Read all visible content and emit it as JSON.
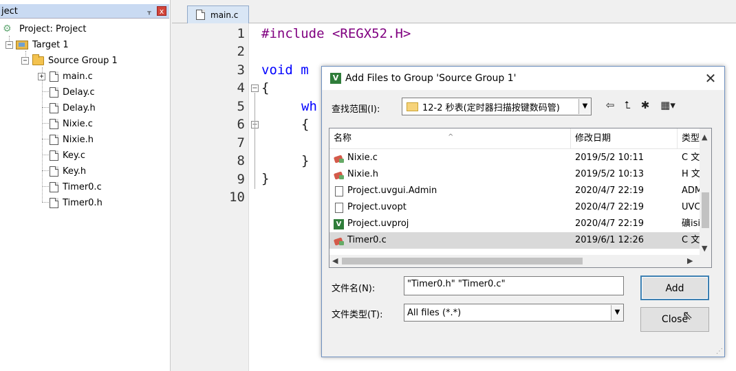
{
  "project_panel": {
    "title": "ject",
    "pin": "⊥",
    "close": "x",
    "tree": {
      "project": "Project: Project",
      "target": "Target 1",
      "group": "Source Group 1",
      "files": [
        "main.c",
        "Delay.c",
        "Delay.h",
        "Nixie.c",
        "Nixie.h",
        "Key.c",
        "Key.h",
        "Timer0.c",
        "Timer0.h"
      ]
    }
  },
  "editor": {
    "tab": "main.c",
    "line_numbers": [
      "1",
      "2",
      "3",
      "4",
      "5",
      "6",
      "7",
      "8",
      "9",
      "10"
    ],
    "code": {
      "l1": "#include <REGX52.H>",
      "l3": "void m",
      "l4": "{",
      "l5": "wh",
      "l6": "{",
      "l8": "}",
      "l9": "}"
    }
  },
  "dialog": {
    "title": "Add Files to Group 'Source Group 1'",
    "close": "✕",
    "look_in_label": "查找范围(I):",
    "look_in_value": "12-2 秒表(定时器扫描按键数码管)",
    "columns": {
      "name": "名称",
      "date": "修改日期",
      "type": "类型"
    },
    "files": [
      {
        "name": "Nixie.c",
        "date": "2019/5/2 10:11",
        "type": "C 文",
        "icon": "c-source-icon"
      },
      {
        "name": "Nixie.h",
        "date": "2019/5/2 10:13",
        "type": "H 文",
        "icon": "c-header-icon"
      },
      {
        "name": "Project.uvgui.Admin",
        "date": "2020/4/7 22:19",
        "type": "ADM",
        "icon": "generic-file-icon"
      },
      {
        "name": "Project.uvopt",
        "date": "2020/4/7 22:19",
        "type": "UVC",
        "icon": "generic-file-icon"
      },
      {
        "name": "Project.uvproj",
        "date": "2020/4/7 22:19",
        "type": "礦isi",
        "icon": "uvision-project-icon"
      },
      {
        "name": "Timer0.c",
        "date": "2019/6/1 12:26",
        "type": "C 文",
        "icon": "c-source-icon",
        "selected": true
      }
    ],
    "filename_label": "文件名(N):",
    "filename_value": "\"Timer0.h\" \"Timer0.c\"",
    "filetype_label": "文件类型(T):",
    "filetype_value": "All files (*.*)",
    "add_button": "Add",
    "close_button": "Close"
  },
  "colors": {
    "keyword": "#0000ff",
    "preprocessor": "#800080",
    "selection": "#d9d9d9",
    "accent": "#3c7fb1"
  }
}
